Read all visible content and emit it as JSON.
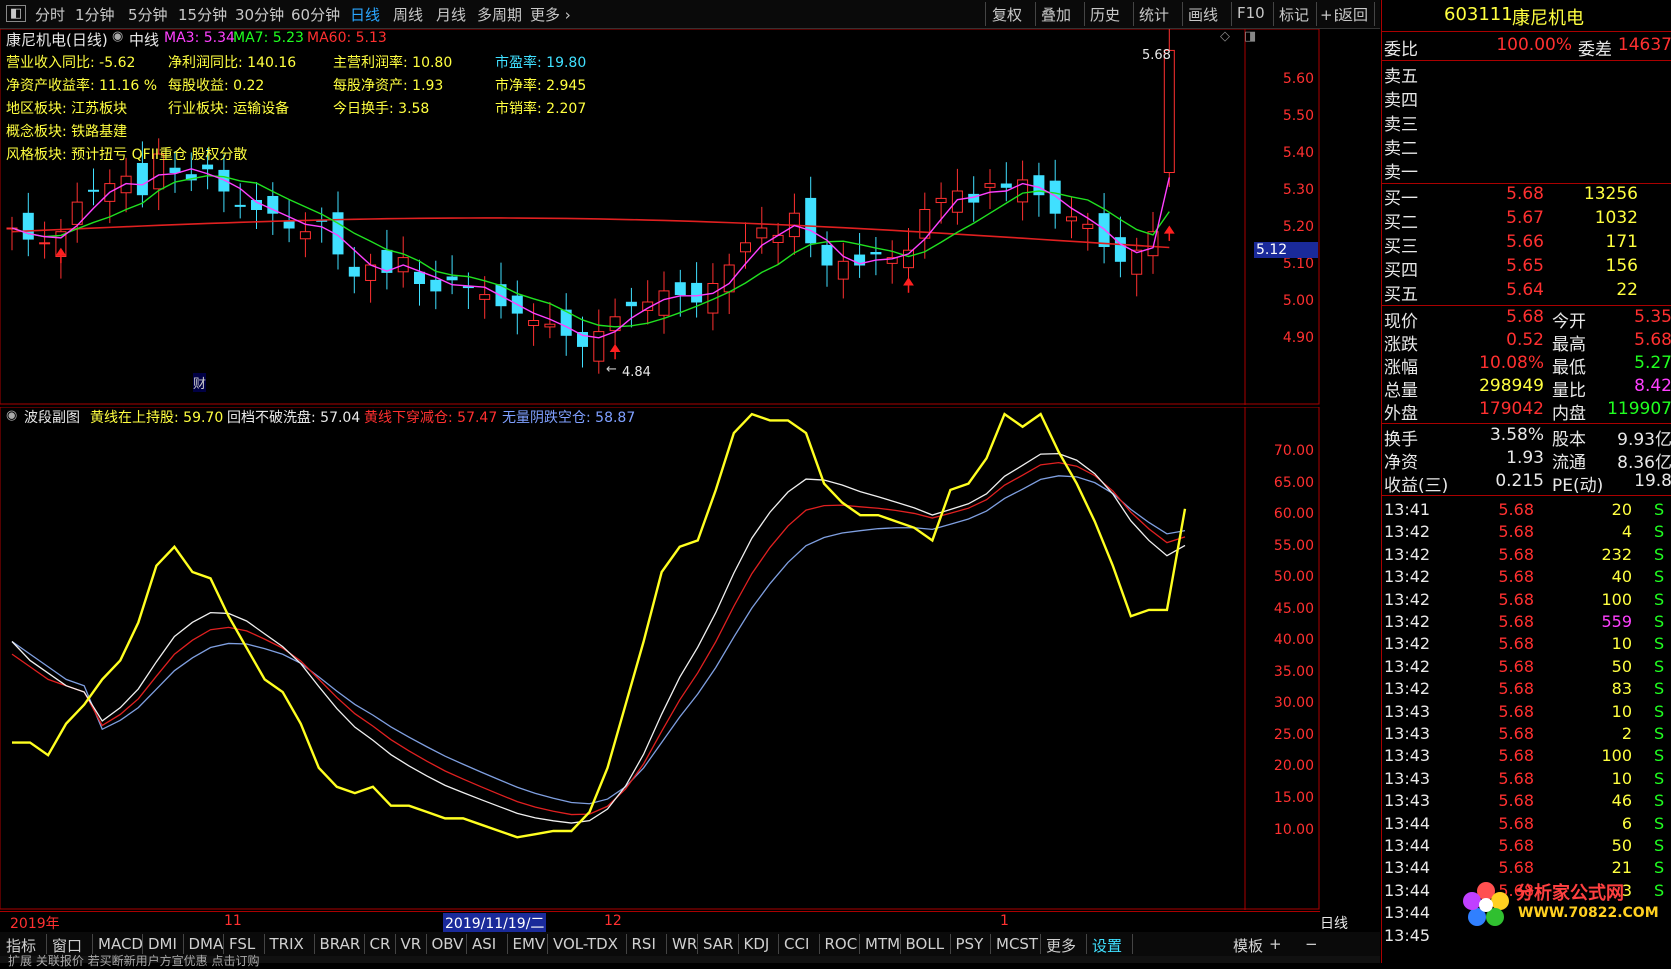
{
  "toolbar": {
    "left_items": [
      "分时",
      "1分钟",
      "5分钟",
      "15分钟",
      "30分钟",
      "60分钟",
      "日线",
      "周线",
      "月线",
      "多周期",
      "更多"
    ],
    "active": "日线",
    "right_items": [
      "复权",
      "叠加",
      "历史",
      "统计",
      "画线",
      "F10",
      "标记",
      "+自选",
      "返回"
    ]
  },
  "main_chart": {
    "title": "康尼机电(日线)",
    "period": "中线",
    "ma3": "MA3: 5.34",
    "ma7": "MA7: 5.23",
    "ma60": "MA60: 5.13",
    "info_rows": [
      [
        "营业收入同比: -5.62",
        "净利润同比: 140.16",
        "主营利润率: 10.80",
        "市盈率: 19.80"
      ],
      [
        "净资产收益率: 11.16 %",
        "每股收益: 0.22",
        "每股净资产: 1.93",
        "市净率: 2.945"
      ],
      [
        "地区板块: 江苏板块",
        "行业板块: 运输设备",
        "今日换手: 3.58",
        "市销率: 2.207"
      ],
      [
        "概念板块: 铁路基建"
      ],
      [
        "风格板块: 预计扭亏 QFII重仓 股权分散"
      ]
    ],
    "high_label": "5.68",
    "low_label": "4.84",
    "cai_label": "财",
    "current_price_tag": "5.12",
    "y_ticks": [
      "5.60",
      "5.50",
      "5.40",
      "5.30",
      "5.20",
      "5.10",
      "5.00",
      "4.90"
    ],
    "colors": {
      "up": "#ff3030",
      "down": "#40e0ff",
      "ma3": "#ff40ff",
      "ma7": "#20ff20",
      "ma60": "#ff2020"
    }
  },
  "sub_chart": {
    "title": "波段副图",
    "line1": "黄线在上持股: 59.70",
    "line2": "回档不破洗盘: 57.04",
    "line3": "黄线下穿减仓: 57.47",
    "line4": "无量阴跌空仓: 58.87",
    "y_ticks": [
      "70.00",
      "65.00",
      "60.00",
      "55.00",
      "50.00",
      "45.00",
      "40.00",
      "35.00",
      "30.00",
      "25.00",
      "20.00",
      "15.00",
      "10.00"
    ]
  },
  "date_bar": {
    "labels": [
      "2019年",
      "11",
      "2019/11/19/二",
      "12",
      "1"
    ],
    "right_label": "日线"
  },
  "indicator_bar": {
    "items": [
      "指标",
      "窗口",
      "MACD",
      "DMI",
      "DMA",
      "FSL",
      "TRIX",
      "BRAR",
      "CR",
      "VR",
      "OBV",
      "ASI",
      "EMV",
      "VOL-TDX",
      "RSI",
      "WR",
      "SAR",
      "KDJ",
      "CCI",
      "ROC",
      "MTM",
      "BOLL",
      "PSY",
      "MCST",
      "更多",
      "设置"
    ],
    "right_items": [
      "模板",
      "+",
      "−"
    ]
  },
  "footer": {
    "text": "扩展   关联报价   若买断新用户方宣优惠   点击订购"
  },
  "quote": {
    "code": "603111",
    "name": "康尼机电",
    "weibi_label": "委比",
    "weibi": "100.00%",
    "weicha_label": "委差",
    "weicha": "14637",
    "sells": [
      "卖五",
      "卖四",
      "卖三",
      "卖二",
      "卖一"
    ],
    "buys": [
      {
        "label": "买一",
        "price": "5.68",
        "vol": "13256"
      },
      {
        "label": "买二",
        "price": "5.67",
        "vol": "1032"
      },
      {
        "label": "买三",
        "price": "5.66",
        "vol": "171"
      },
      {
        "label": "买四",
        "price": "5.65",
        "vol": "156"
      },
      {
        "label": "买五",
        "price": "5.64",
        "vol": "22"
      }
    ],
    "stats": [
      {
        "l1": "现价",
        "v1": "5.68",
        "l2": "今开",
        "v2": "5.35"
      },
      {
        "l1": "涨跌",
        "v1": "0.52",
        "l2": "最高",
        "v2": "5.68"
      },
      {
        "l1": "涨幅",
        "v1": "10.08%",
        "l2": "最低",
        "v2": "5.27"
      },
      {
        "l1": "总量",
        "v1": "298949",
        "l2": "量比",
        "v2": "8.42"
      },
      {
        "l1": "外盘",
        "v1": "179042",
        "l2": "内盘",
        "v2": "119907"
      }
    ],
    "stats2": [
      {
        "l1": "换手",
        "v1": "3.58%",
        "l2": "股本",
        "v2": "9.93亿"
      },
      {
        "l1": "净资",
        "v1": "1.93",
        "l2": "流通",
        "v2": "8.36亿"
      },
      {
        "l1": "收益(三)",
        "v1": "0.215",
        "l2": "PE(动)",
        "v2": "19.8"
      }
    ],
    "ticks": [
      {
        "t": "13:41",
        "p": "5.68",
        "v": "20",
        "s": "S"
      },
      {
        "t": "13:42",
        "p": "5.68",
        "v": "4",
        "s": "S"
      },
      {
        "t": "13:42",
        "p": "5.68",
        "v": "232",
        "s": "S"
      },
      {
        "t": "13:42",
        "p": "5.68",
        "v": "40",
        "s": "S"
      },
      {
        "t": "13:42",
        "p": "5.68",
        "v": "100",
        "s": "S"
      },
      {
        "t": "13:42",
        "p": "5.68",
        "v": "559",
        "s": "S"
      },
      {
        "t": "13:42",
        "p": "5.68",
        "v": "10",
        "s": "S"
      },
      {
        "t": "13:42",
        "p": "5.68",
        "v": "50",
        "s": "S"
      },
      {
        "t": "13:42",
        "p": "5.68",
        "v": "83",
        "s": "S"
      },
      {
        "t": "13:43",
        "p": "5.68",
        "v": "10",
        "s": "S"
      },
      {
        "t": "13:43",
        "p": "5.68",
        "v": "2",
        "s": "S"
      },
      {
        "t": "13:43",
        "p": "5.68",
        "v": "100",
        "s": "S"
      },
      {
        "t": "13:43",
        "p": "5.68",
        "v": "10",
        "s": "S"
      },
      {
        "t": "13:43",
        "p": "5.68",
        "v": "46",
        "s": "S"
      },
      {
        "t": "13:44",
        "p": "5.68",
        "v": "6",
        "s": "S"
      },
      {
        "t": "13:44",
        "p": "5.68",
        "v": "50",
        "s": "S"
      },
      {
        "t": "13:44",
        "p": "5.68",
        "v": "21",
        "s": "S"
      },
      {
        "t": "13:44",
        "p": "5.68",
        "v": "3",
        "s": "S"
      },
      {
        "t": "13:44",
        "p": "",
        "v": "",
        "s": ""
      },
      {
        "t": "13:45",
        "p": "",
        "v": "",
        "s": ""
      }
    ],
    "watermark": "分析家公式网",
    "watermark_url": "WWW.70822.COM"
  }
}
